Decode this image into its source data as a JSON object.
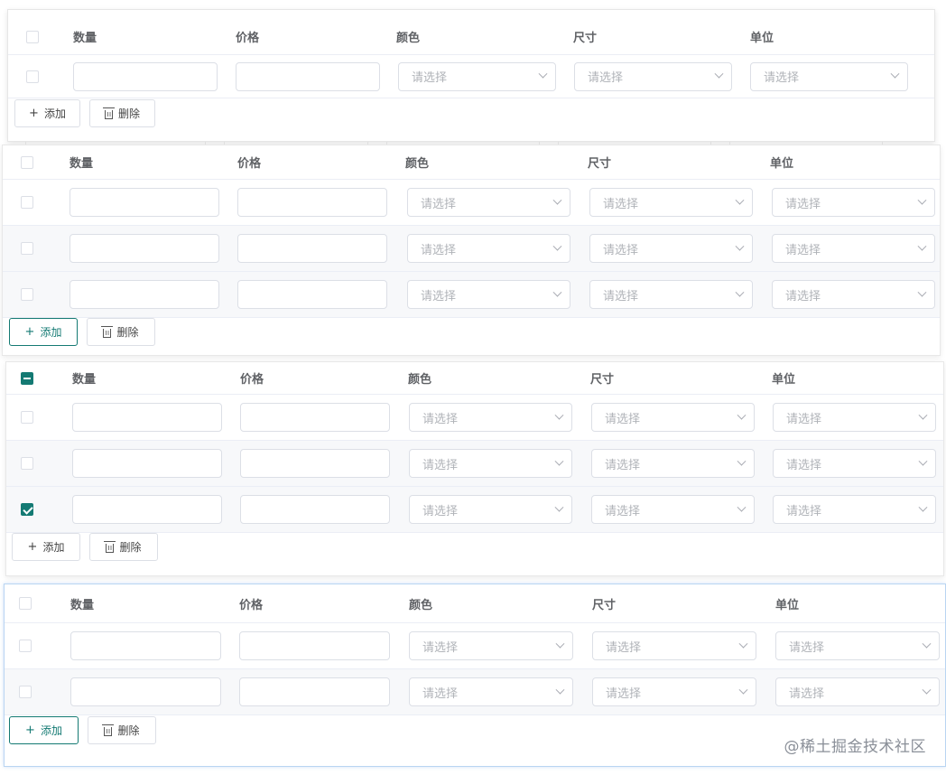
{
  "columns": [
    "数量",
    "价格",
    "颜色",
    "尺寸",
    "单位"
  ],
  "select_placeholder": "请选择",
  "add_label": "添加",
  "delete_label": "删除",
  "watermark": "@稀土掘金技术社区",
  "accent_color": "#147a73",
  "panels": [
    {
      "header_checkbox": "unchecked",
      "add_active": false,
      "rows": [
        "unchecked"
      ]
    },
    {
      "header_checkbox": "unchecked",
      "add_active": true,
      "rows": [
        "unchecked",
        "unchecked",
        "unchecked"
      ]
    },
    {
      "header_checkbox": "indeterminate",
      "add_active": false,
      "rows": [
        "unchecked",
        "unchecked",
        "checked"
      ]
    },
    {
      "header_checkbox": "unchecked",
      "add_active": true,
      "rows": [
        "unchecked",
        "unchecked"
      ]
    }
  ]
}
